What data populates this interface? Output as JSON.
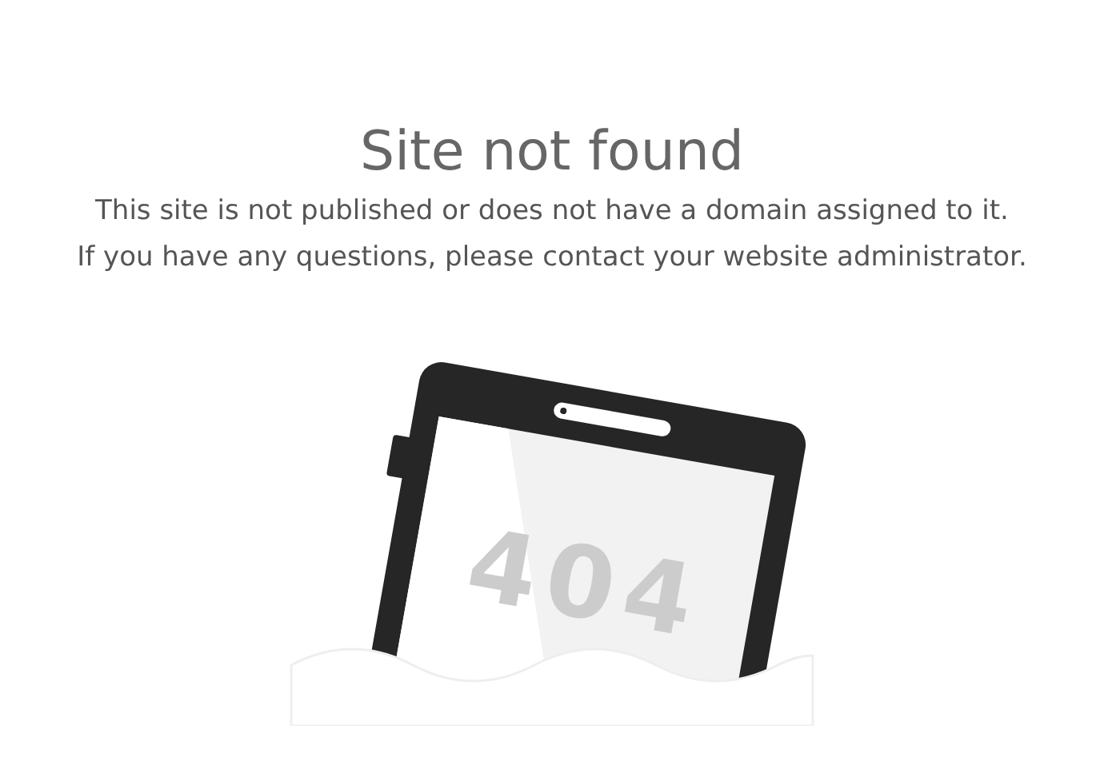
{
  "title": "Site not found",
  "message": [
    "This site is not published or does not have a domain assigned to it.",
    "If you have any questions, please contact your website administrator."
  ],
  "illustration": {
    "screen_text": "404"
  }
}
